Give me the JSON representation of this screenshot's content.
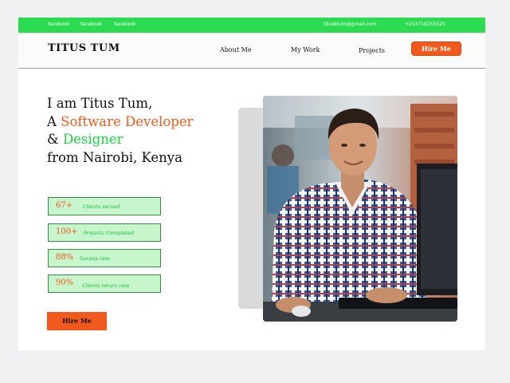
{
  "topbar": {
    "links": [
      "facebook",
      "facebook",
      "facebook"
    ],
    "email": "titusktum@gmail.com",
    "phone": "+254716255525"
  },
  "navbar": {
    "logo": "TITUS TUM",
    "items": [
      "About Me",
      "My Work",
      "Projects"
    ],
    "cta": "Hire Me"
  },
  "hero": {
    "line1": "I am Titus Tum,",
    "line2_prefix": "A ",
    "line2_highlight": "Software Developer",
    "line3_prefix": "& ",
    "line3_highlight": "Designer",
    "line4": "from Nairobi, Kenya"
  },
  "stats": [
    {
      "value": "67+",
      "label": "Clients served"
    },
    {
      "value": "100+",
      "label": "Projects Completed"
    },
    {
      "value": "88%",
      "label": "Sucess rate"
    },
    {
      "value": "90%",
      "label": "Clients return rate"
    }
  ],
  "cta": {
    "label": "Hire Me"
  },
  "colors": {
    "accent_green": "#2bdb50",
    "accent_orange": "#f25a1d",
    "stat_bg": "#c7f6cc"
  }
}
